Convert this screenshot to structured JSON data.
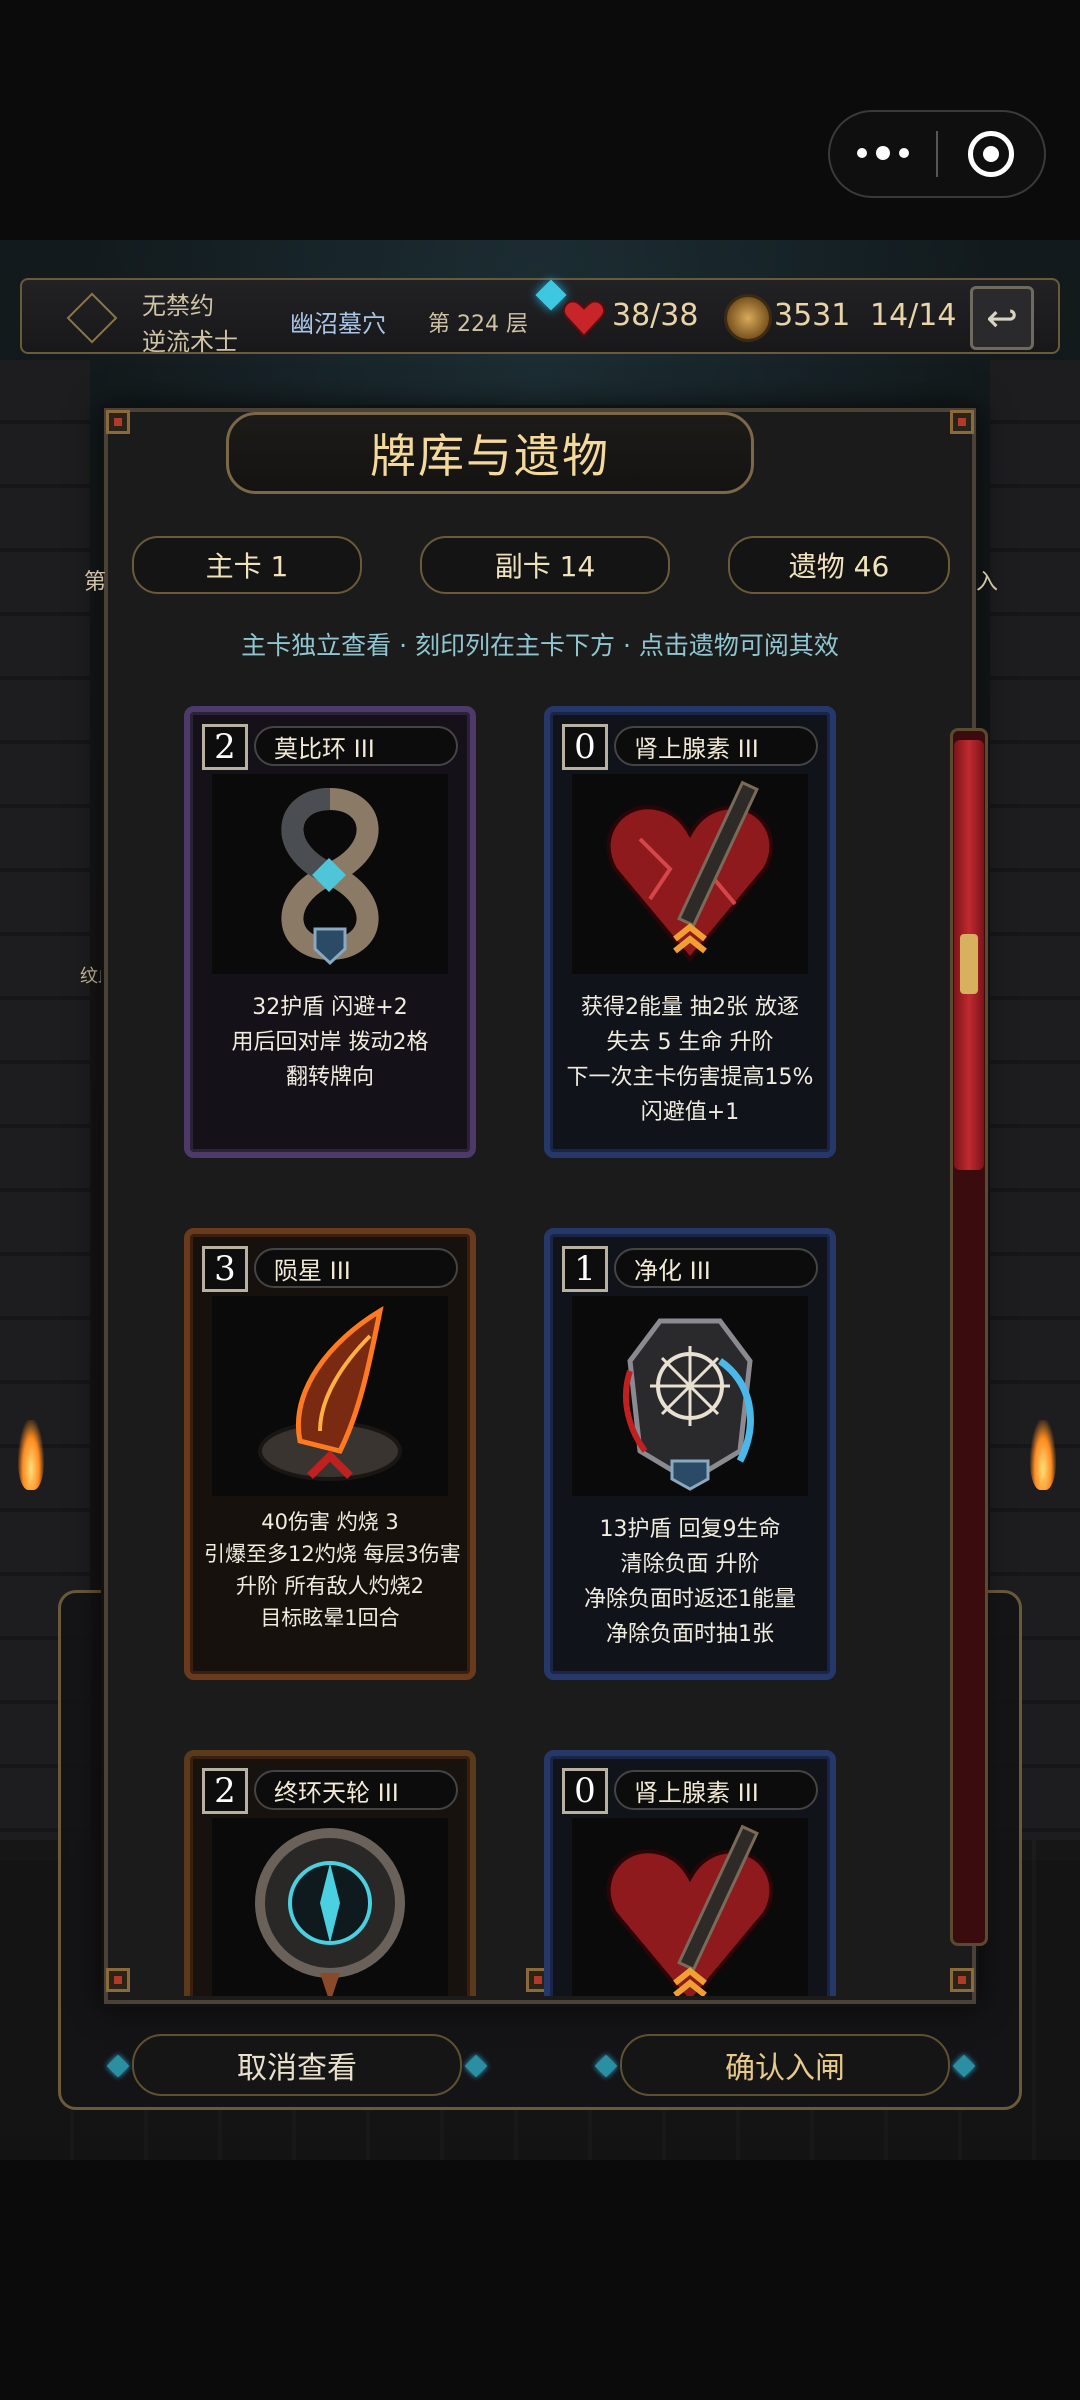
{
  "capsule": {
    "more_icon": "more-dots-icon",
    "close_icon": "target-circle-icon"
  },
  "status": {
    "oath": "无禁约",
    "class_name": "逆流术士",
    "location": "幽沼墓穴",
    "floor": "第 224 层",
    "hp": "38/38",
    "gold": "3531",
    "deck_count": "14/14",
    "heart_color": "#c8252a"
  },
  "modal": {
    "title": "牌库与遗物",
    "tabs": [
      {
        "label": "主卡  1"
      },
      {
        "label": "副卡  14"
      },
      {
        "label": "遗物  46"
      }
    ],
    "left_edge_text": "第",
    "right_edge_text": "入",
    "side_label": "纹血",
    "hint": "主卡独立查看 · 刻印列在主卡下方 · 点击遗物可阅其效"
  },
  "cards": [
    {
      "cost": "2",
      "name": "莫比环 III",
      "frame": "purple",
      "desc": [
        "32护盾 闪避+2",
        "用后回对岸 拨动2格",
        "翻转牌向"
      ]
    },
    {
      "cost": "0",
      "name": "肾上腺素 III",
      "frame": "blue",
      "desc": [
        "获得2能量 抽2张 放逐",
        "失去 5 生命 升阶",
        "下一次主卡伤害提高15%",
        "闪避值+1"
      ]
    },
    {
      "cost": "3",
      "name": "陨星 III",
      "frame": "red",
      "desc": [
        "40伤害 灼烧 3",
        "引爆至多12灼烧 每层3伤害",
        "升阶 所有敌人灼烧2",
        "目标眩晕1回合"
      ]
    },
    {
      "cost": "1",
      "name": "净化 III",
      "frame": "blue",
      "desc": [
        "13护盾 回复9生命",
        "清除负面 升阶",
        "净除负面时返还1能量",
        "净除负面时抽1张"
      ]
    },
    {
      "cost": "2",
      "name": "终环天轮 III",
      "frame": "red2",
      "desc": []
    },
    {
      "cost": "0",
      "name": "肾上腺素 III",
      "frame": "blue",
      "desc": []
    }
  ],
  "buttons": {
    "cancel": "取消查看",
    "confirm": "确认入闸"
  },
  "colors": {
    "accent_gold": "#f4d99a",
    "hint_cyan": "#8fc6cf",
    "confirm_text": "#e7c98a"
  }
}
